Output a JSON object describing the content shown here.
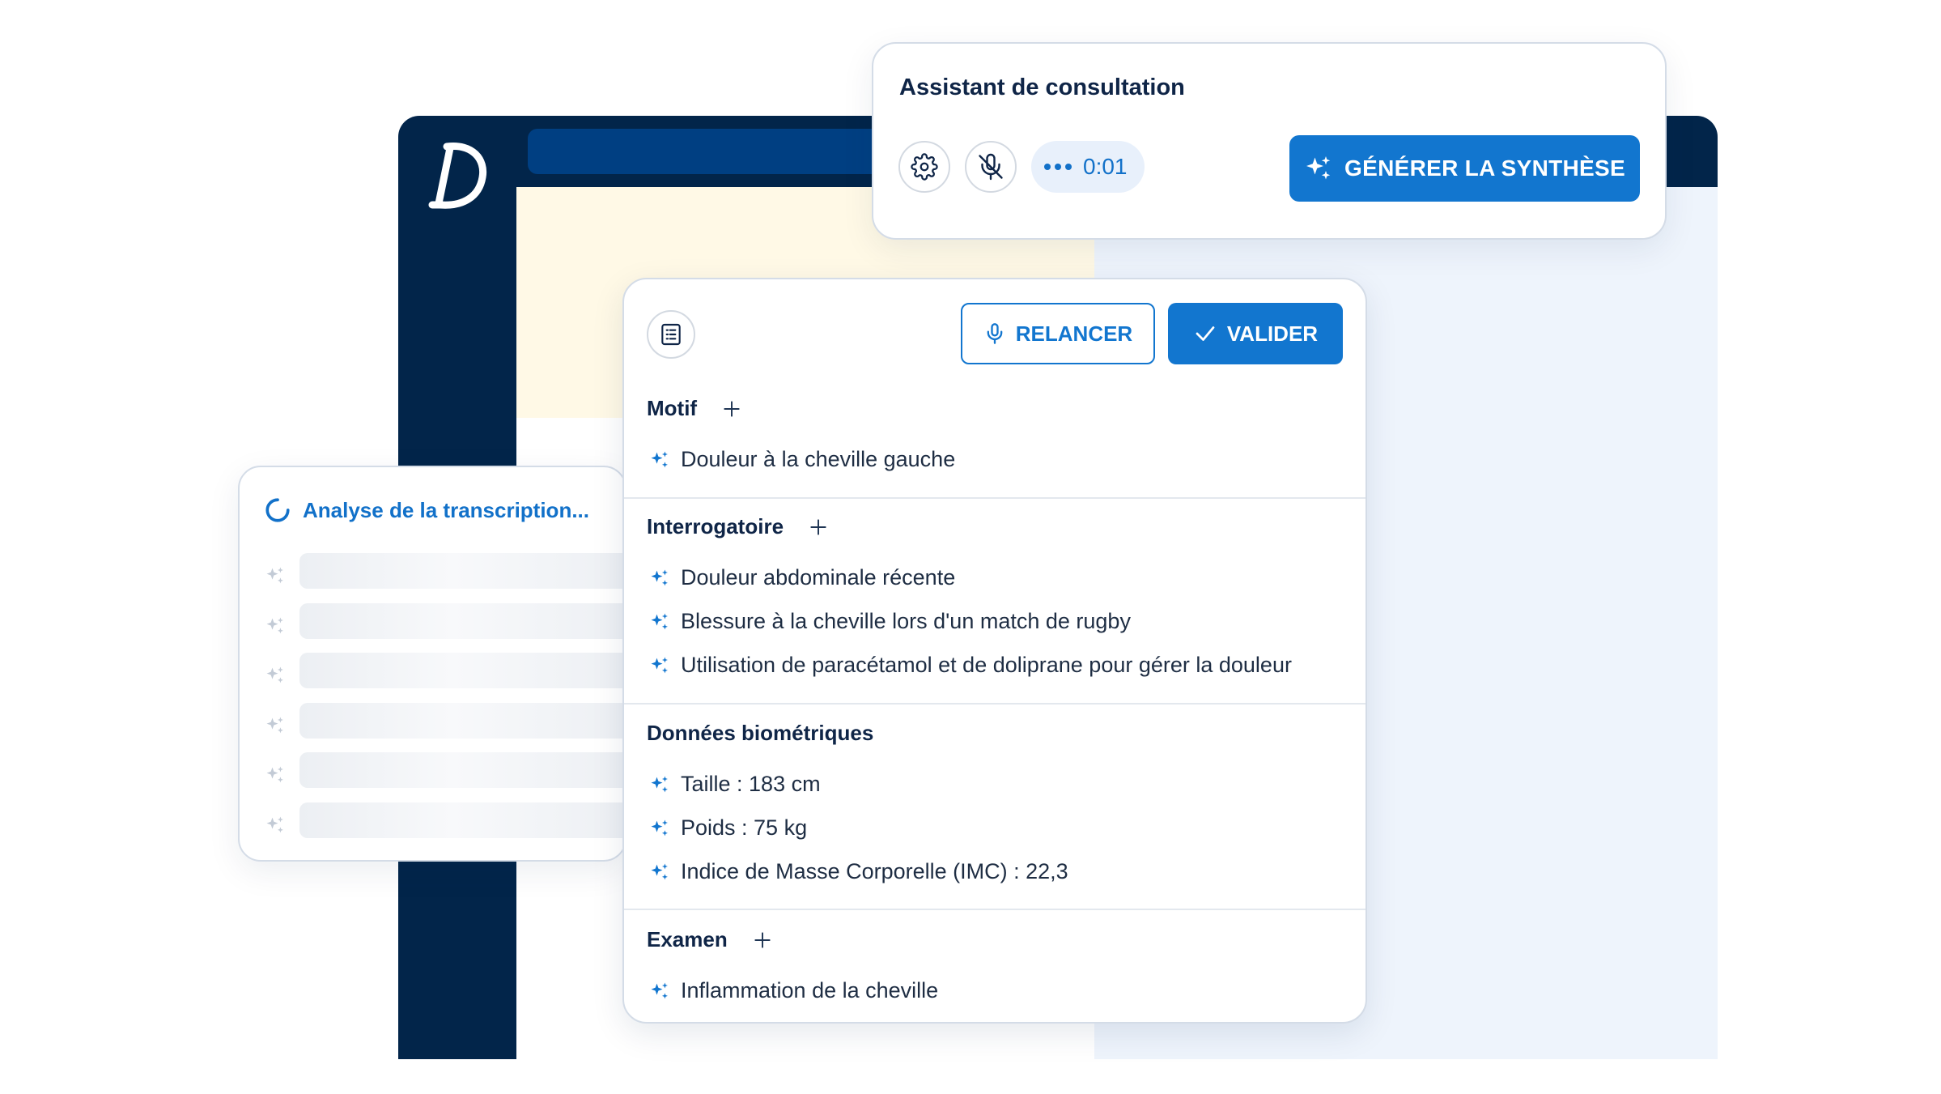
{
  "assistant": {
    "title": "Assistant de consultation",
    "timer": "0:01",
    "generate_label": "GÉNÉRER LA SYNTHÈSE"
  },
  "loading": {
    "title": "Analyse de la transcription..."
  },
  "summary": {
    "relancer_label": "RELANCER",
    "valider_label": "VALIDER",
    "sections": [
      {
        "title": "Motif",
        "items": [
          "Douleur à la cheville gauche"
        ]
      },
      {
        "title": "Interrogatoire",
        "items": [
          "Douleur abdominale récente",
          "Blessure à la cheville lors d'un match de rugby",
          "Utilisation de paracétamol et de doliprane pour gérer la douleur"
        ]
      },
      {
        "title": "Données biométriques",
        "items": [
          "Taille : 183 cm",
          "Poids : 75 kg",
          "Indice de Masse Corporelle (IMC) : 22,3"
        ]
      },
      {
        "title": "Examen",
        "items": [
          "Inflammation de la cheville"
        ]
      }
    ]
  },
  "colors": {
    "navy": "#02254a",
    "primary_blue": "#1276cf",
    "text_dark": "#0f2547"
  },
  "icons": [
    "app-logo-d",
    "gear-icon",
    "mic-off-icon",
    "sparkle-icon",
    "spinner-icon",
    "document-list-icon",
    "mic-icon",
    "check-icon",
    "plus-icon"
  ]
}
